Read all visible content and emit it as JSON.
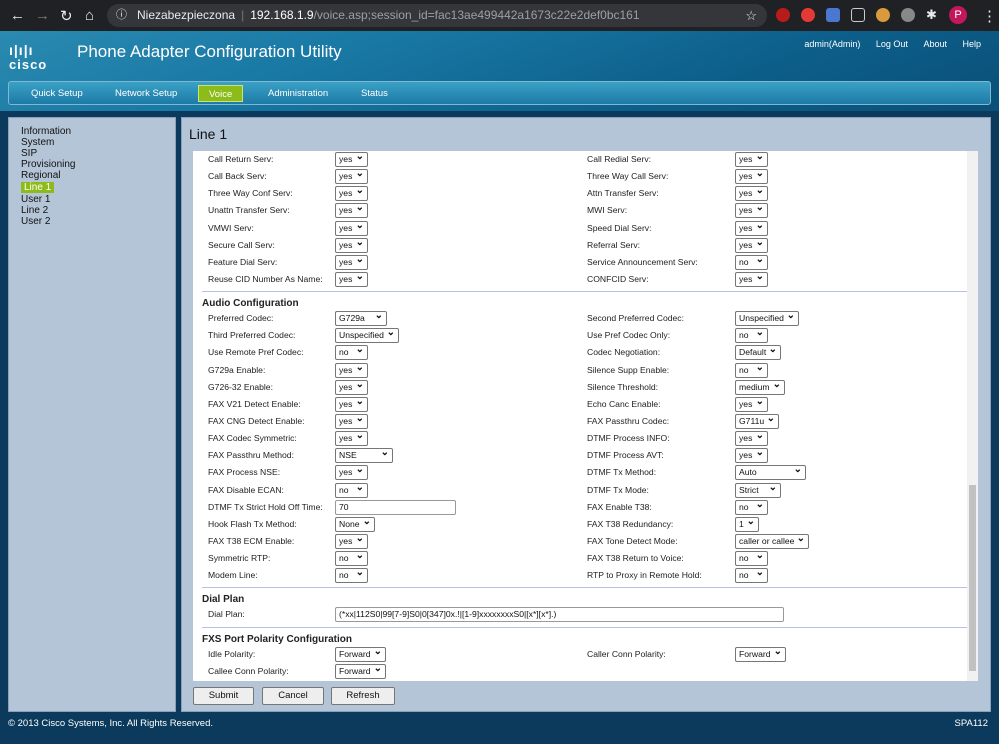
{
  "browser": {
    "security": "Niezabezpieczona",
    "host": "192.168.1.9",
    "path": "/voice.asp;session_id=fac13ae499442a1673c22e2def0bc161",
    "profile": "P"
  },
  "header": {
    "logo": "cisco",
    "title": "Phone Adapter Configuration Utility",
    "user": "admin(Admin)",
    "logout": "Log Out",
    "about": "About",
    "help": "Help"
  },
  "nav": {
    "tabs": [
      "Quick Setup",
      "Network Setup",
      "Voice",
      "Administration",
      "Status"
    ],
    "active": "Voice",
    "accent": "#8dbb1a"
  },
  "sidebar": {
    "items": [
      "Information",
      "System",
      "SIP",
      "Provisioning",
      "Regional",
      "Line 1",
      "User 1",
      "Line 2",
      "User 2"
    ],
    "selected": "Line 1"
  },
  "page": {
    "title": "Line 1"
  },
  "sections": [
    {
      "title": "",
      "rows": [
        [
          {
            "label": "Call Return Serv:",
            "value": "yes"
          },
          {
            "label": "Call Redial Serv:",
            "value": "yes"
          }
        ],
        [
          {
            "label": "Call Back Serv:",
            "value": "yes"
          },
          {
            "label": "Three Way Call Serv:",
            "value": "yes"
          }
        ],
        [
          {
            "label": "Three Way Conf Serv:",
            "value": "yes"
          },
          {
            "label": "Attn Transfer Serv:",
            "value": "yes"
          }
        ],
        [
          {
            "label": "Unattn Transfer Serv:",
            "value": "yes"
          },
          {
            "label": "MWI Serv:",
            "value": "yes"
          }
        ],
        [
          {
            "label": "VMWI Serv:",
            "value": "yes"
          },
          {
            "label": "Speed Dial Serv:",
            "value": "yes"
          }
        ],
        [
          {
            "label": "Secure Call Serv:",
            "value": "yes"
          },
          {
            "label": "Referral Serv:",
            "value": "yes"
          }
        ],
        [
          {
            "label": "Feature Dial Serv:",
            "value": "yes"
          },
          {
            "label": "Service Announcement Serv:",
            "value": "no"
          }
        ],
        [
          {
            "label": "Reuse CID Number As Name:",
            "value": "yes"
          },
          {
            "label": "CONFCID Serv:",
            "value": "yes"
          }
        ]
      ]
    },
    {
      "title": "Audio Configuration",
      "rows": [
        [
          {
            "label": "Preferred Codec:",
            "value": "G729a"
          },
          {
            "label": "Second Preferred Codec:",
            "value": "Unspecified"
          }
        ],
        [
          {
            "label": "Third Preferred Codec:",
            "value": "Unspecified"
          },
          {
            "label": "Use Pref Codec Only:",
            "value": "no"
          }
        ],
        [
          {
            "label": "Use Remote Pref Codec:",
            "value": "no"
          },
          {
            "label": "Codec Negotiation:",
            "value": "Default"
          }
        ],
        [
          {
            "label": "G729a Enable:",
            "value": "yes"
          },
          {
            "label": "Silence Supp Enable:",
            "value": "no"
          }
        ],
        [
          {
            "label": "G726-32 Enable:",
            "value": "yes"
          },
          {
            "label": "Silence Threshold:",
            "value": "medium"
          }
        ],
        [
          {
            "label": "FAX V21 Detect Enable:",
            "value": "yes"
          },
          {
            "label": "Echo Canc Enable:",
            "value": "yes"
          }
        ],
        [
          {
            "label": "FAX CNG Detect Enable:",
            "value": "yes"
          },
          {
            "label": "FAX Passthru Codec:",
            "value": "G711u"
          }
        ],
        [
          {
            "label": "FAX Codec Symmetric:",
            "value": "yes"
          },
          {
            "label": "DTMF Process INFO:",
            "value": "yes"
          }
        ],
        [
          {
            "label": "FAX Passthru Method:",
            "value": "NSE"
          },
          {
            "label": "DTMF Process AVT:",
            "value": "yes"
          }
        ],
        [
          {
            "label": "FAX Process NSE:",
            "value": "yes"
          },
          {
            "label": "DTMF Tx Method:",
            "value": "Auto"
          }
        ],
        [
          {
            "label": "FAX Disable ECAN:",
            "value": "no"
          },
          {
            "label": "DTMF Tx Mode:",
            "value": "Strict"
          }
        ],
        [
          {
            "label": "DTMF Tx Strict Hold Off Time:",
            "value": "70",
            "input": true
          },
          {
            "label": "FAX Enable T38:",
            "value": "no"
          }
        ],
        [
          {
            "label": "Hook Flash Tx Method:",
            "value": "None"
          },
          {
            "label": "FAX T38 Redundancy:",
            "value": "1"
          }
        ],
        [
          {
            "label": "FAX T38 ECM Enable:",
            "value": "yes"
          },
          {
            "label": "FAX Tone Detect Mode:",
            "value": "caller or callee"
          }
        ],
        [
          {
            "label": "Symmetric RTP:",
            "value": "no"
          },
          {
            "label": "FAX T38 Return to Voice:",
            "value": "no"
          }
        ],
        [
          {
            "label": "Modem Line:",
            "value": "no"
          },
          {
            "label": "RTP to Proxy in Remote Hold:",
            "value": "no"
          }
        ]
      ]
    },
    {
      "title": "Dial Plan",
      "rows": [
        [
          {
            "label": "Dial Plan:",
            "value": "(*xx|112S0|99[7-9]S0|0[347]0x.!|[1-9]xxxxxxxxS0|[x*][x*].)",
            "input": true,
            "wide": true
          }
        ]
      ]
    },
    {
      "title": "FXS Port Polarity Configuration",
      "rows": [
        [
          {
            "label": "Idle Polarity:",
            "value": "Forward"
          },
          {
            "label": "Caller Conn Polarity:",
            "value": "Forward"
          }
        ],
        [
          {
            "label": "Callee Conn Polarity:",
            "value": "Forward"
          }
        ]
      ]
    }
  ],
  "buttons": {
    "submit": "Submit",
    "cancel": "Cancel",
    "refresh": "Refresh"
  },
  "footer": {
    "copyright": "© 2013 Cisco Systems, Inc. All Rights Reserved.",
    "model": "SPA112"
  }
}
